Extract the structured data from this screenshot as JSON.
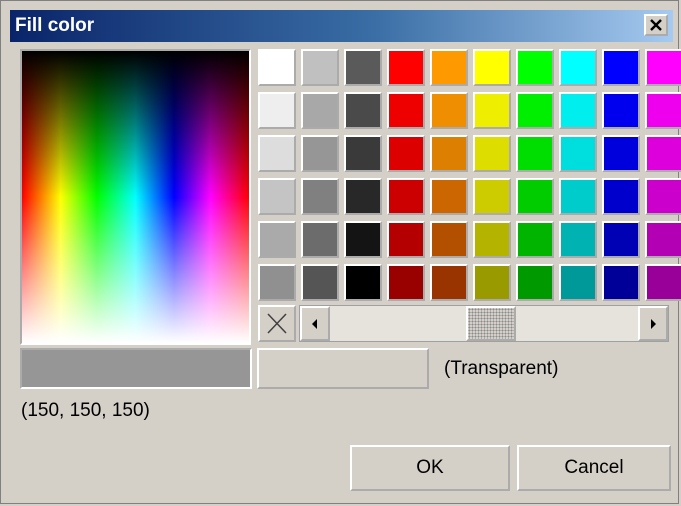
{
  "window": {
    "title": "Fill color",
    "close_icon": "close-x-icon"
  },
  "palette": {
    "columns": [
      {
        "name": "white",
        "shades": [
          "#ffffff",
          "#eeeeee",
          "#dddddd",
          "#c4c4c4",
          "#aaaaaa",
          "#909090"
        ]
      },
      {
        "name": "light-gray",
        "shades": [
          "#c0c0c0",
          "#a8a8a8",
          "#969696",
          "#808080",
          "#6c6c6c",
          "#555555"
        ]
      },
      {
        "name": "dark-gray",
        "shades": [
          "#5a5a5a",
          "#4a4a4a",
          "#3a3a3a",
          "#282828",
          "#141414",
          "#000000"
        ]
      },
      {
        "name": "red",
        "shades": [
          "#ff0000",
          "#ee0000",
          "#dd0000",
          "#cc0000",
          "#b40000",
          "#990000"
        ]
      },
      {
        "name": "orange",
        "shades": [
          "#ff9900",
          "#ee8e00",
          "#dd7f00",
          "#cc6600",
          "#b35000",
          "#993300"
        ]
      },
      {
        "name": "yellow",
        "shades": [
          "#ffff00",
          "#eeee00",
          "#dddd00",
          "#cccc00",
          "#b3b300",
          "#999900"
        ]
      },
      {
        "name": "green",
        "shades": [
          "#00ff00",
          "#00ee00",
          "#00dd00",
          "#00cc00",
          "#00b400",
          "#009900"
        ]
      },
      {
        "name": "cyan",
        "shades": [
          "#00ffff",
          "#00eeee",
          "#00dddd",
          "#00cccc",
          "#00b3b3",
          "#009999"
        ]
      },
      {
        "name": "blue",
        "shades": [
          "#0000ff",
          "#0000ee",
          "#0000dd",
          "#0000cc",
          "#0000b4",
          "#000099"
        ]
      },
      {
        "name": "magenta",
        "shades": [
          "#ff00ff",
          "#ee00ee",
          "#dd00dd",
          "#cc00cc",
          "#b400b4",
          "#990099"
        ]
      }
    ]
  },
  "transparent_button": {
    "icon": "x-no-fill-icon"
  },
  "scrollbar": {
    "left_icon": "arrow-left-icon",
    "right_icon": "arrow-right-icon"
  },
  "preview": {
    "current_color": "#969696",
    "transparent_label": "(Transparent)"
  },
  "rgb_readout": "(150, 150, 150)",
  "buttons": {
    "ok_label": "OK",
    "cancel_label": "Cancel"
  }
}
